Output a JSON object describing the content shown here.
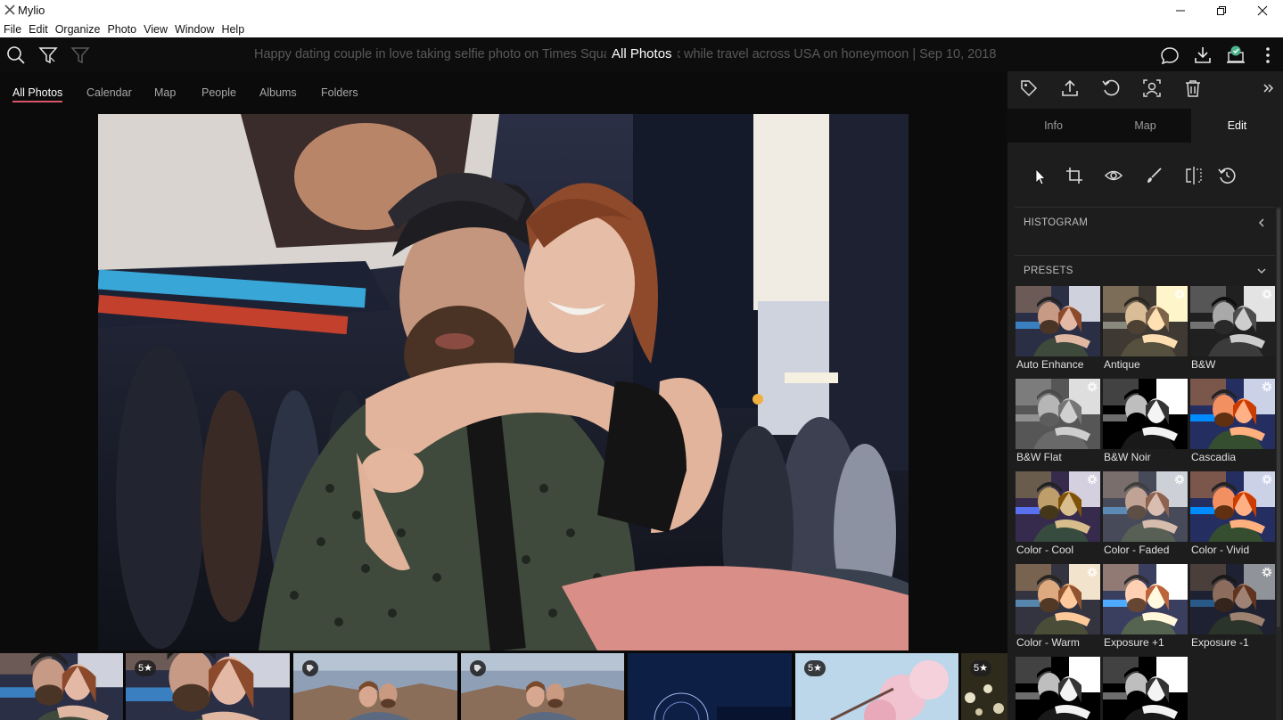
{
  "window": {
    "title": "Mylio"
  },
  "menu": [
    "File",
    "Edit",
    "Organize",
    "Photo",
    "View",
    "Window",
    "Help"
  ],
  "toolbar": {
    "caption": "Happy dating couple in love taking selfie photo on Times Square New York while travel across USA on honeymoon | Sep 10, 2018",
    "view_title": "All Photos"
  },
  "nav_tabs": [
    {
      "label": "All Photos",
      "active": true
    },
    {
      "label": "Calendar",
      "active": false
    },
    {
      "label": "Map",
      "active": false
    },
    {
      "label": "People",
      "active": false
    },
    {
      "label": "Albums",
      "active": false
    },
    {
      "label": "Folders",
      "active": false
    }
  ],
  "right_panel": {
    "tabs": [
      {
        "label": "Info",
        "active": false
      },
      {
        "label": "Map",
        "active": false
      },
      {
        "label": "Edit",
        "active": true
      }
    ],
    "sections": {
      "histogram": "HISTOGRAM",
      "presets": "PRESETS"
    },
    "presets": [
      {
        "label": "Auto Enhance",
        "style": "color",
        "gear": false
      },
      {
        "label": "Antique",
        "style": "sepia",
        "gear": true
      },
      {
        "label": "B&W",
        "style": "bw",
        "gear": true
      },
      {
        "label": "B&W Flat",
        "style": "bwflat",
        "gear": true
      },
      {
        "label": "B&W Noir",
        "style": "noir",
        "gear": true
      },
      {
        "label": "Cascadia",
        "style": "vivid",
        "gear": true
      },
      {
        "label": "Color - Cool",
        "style": "cool",
        "gear": true
      },
      {
        "label": "Color - Faded",
        "style": "faded",
        "gear": true
      },
      {
        "label": "Color - Vivid",
        "style": "vivid",
        "gear": true
      },
      {
        "label": "Color - Warm",
        "style": "warm",
        "gear": true
      },
      {
        "label": "Exposure +1",
        "style": "bright",
        "gear": true
      },
      {
        "label": "Exposure -1",
        "style": "dark",
        "gear": true
      },
      {
        "label": "",
        "style": "noir",
        "gear": true
      },
      {
        "label": "",
        "style": "noir",
        "gear": true
      }
    ]
  },
  "filmstrip": [
    {
      "badge": "",
      "kind": "couple"
    },
    {
      "badge": "5★",
      "kind": "couple"
    },
    {
      "badge": "tag",
      "kind": "canyon"
    },
    {
      "badge": "tag",
      "kind": "canyon2"
    },
    {
      "badge": "",
      "kind": "night"
    },
    {
      "badge": "5★",
      "kind": "blossom"
    },
    {
      "badge": "5★",
      "kind": "flowers"
    }
  ],
  "colors": {
    "accent": "#d8556a",
    "panel_bg": "#1d1d1d",
    "app_bg": "#0b0b0b",
    "sync_badge": "#4db38a"
  }
}
